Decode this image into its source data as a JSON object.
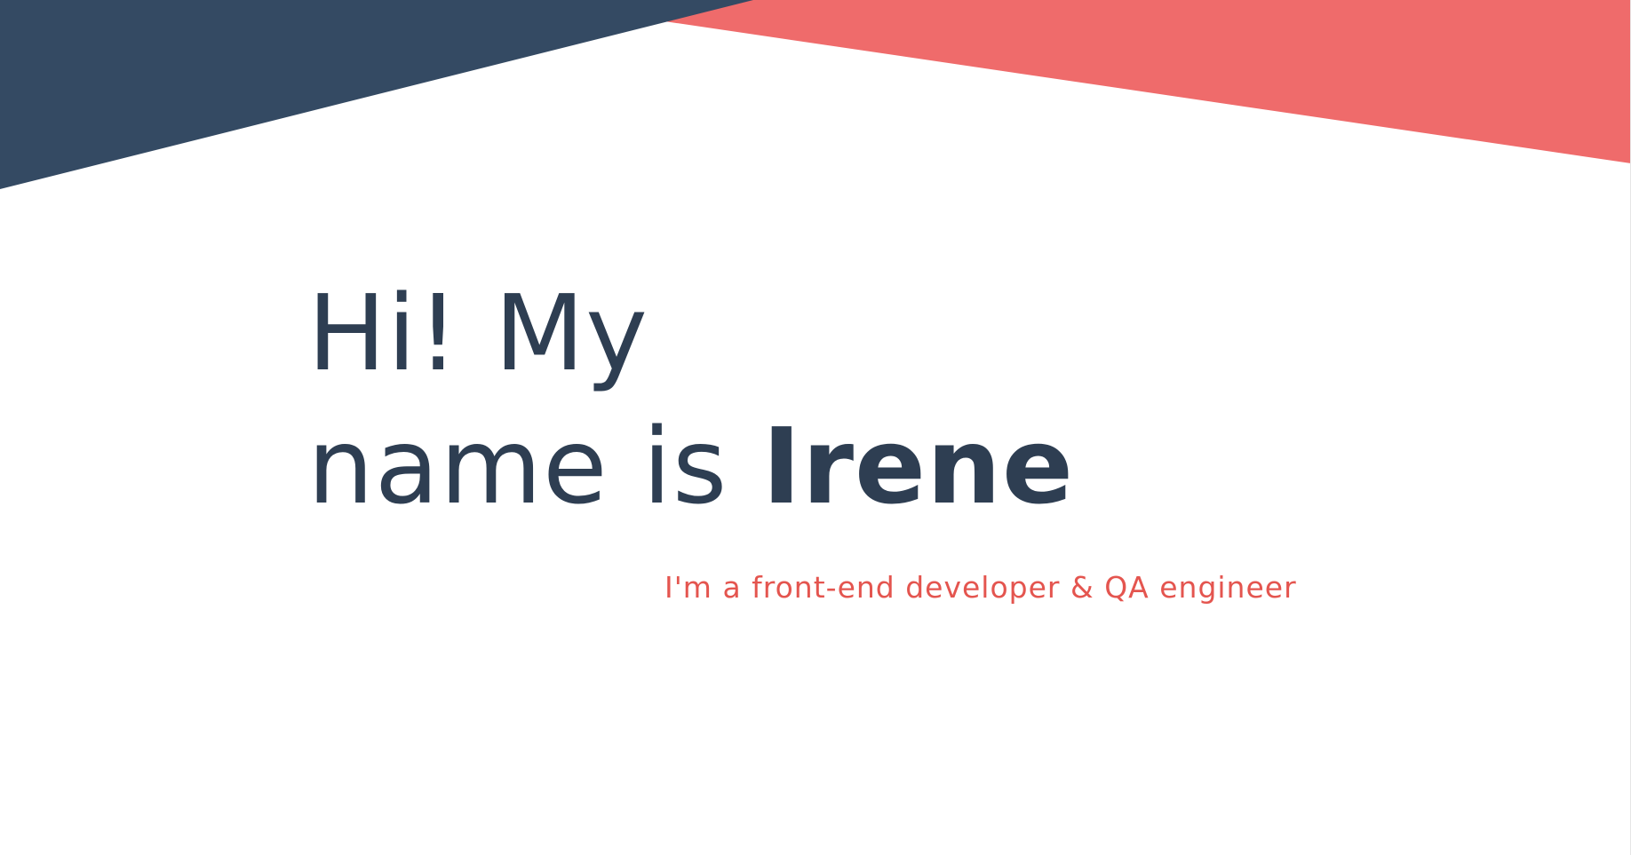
{
  "hero": {
    "greeting": "Hi! My",
    "name_prefix": "name is ",
    "name": "Irene",
    "subtitle": "I'm a front-end developer & QA engineer"
  },
  "colors": {
    "navy": "#344a63",
    "coral": "#ef6b6b",
    "heading_text": "#2e3e52",
    "subtitle_text": "#e4554f",
    "background": "#ffffff"
  }
}
